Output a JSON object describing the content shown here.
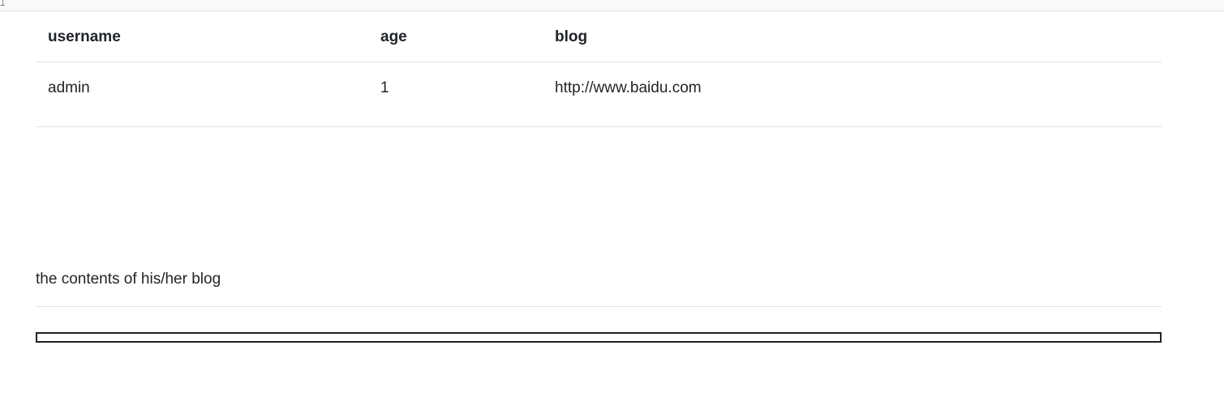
{
  "table": {
    "headers": {
      "username": "username",
      "age": "age",
      "blog": "blog"
    },
    "rows": [
      {
        "username": "admin",
        "age": "1",
        "blog": "http://www.baidu.com"
      }
    ]
  },
  "blog_section": {
    "text": "the contents of his/her blog"
  },
  "icons": {
    "corner": "cursor-icon"
  }
}
